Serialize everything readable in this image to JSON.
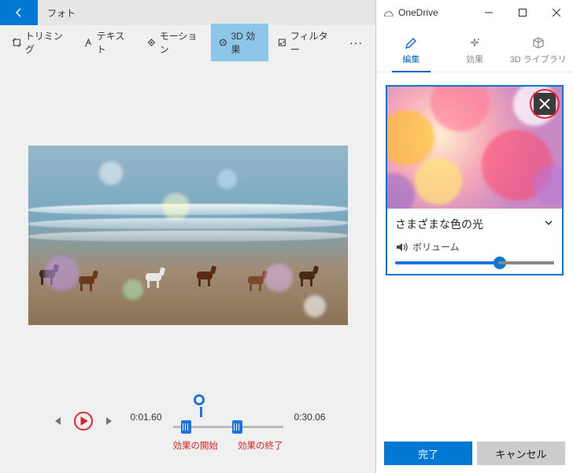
{
  "app_title": "フォト",
  "onedrive_title": "OneDrive",
  "toolbar": {
    "trim": "トリミング",
    "text": "テキスト",
    "motion": "モーション",
    "effects3d": "3D 効果",
    "filters": "フィルター"
  },
  "playback": {
    "current_time": "0:01.60",
    "total_time": "0:30.06",
    "start_label": "効果の開始",
    "end_label": "効果の終了"
  },
  "tabs": {
    "edit": "編集",
    "effects": "効果",
    "library3d": "3D ライブラリ"
  },
  "effect": {
    "name": "さまざまな色の光",
    "volume_label": "ボリューム",
    "volume_value": 65
  },
  "buttons": {
    "done": "完了",
    "cancel": "キャンセル"
  },
  "colors": {
    "accent": "#0078d4",
    "accent_light": "#8cc6e8",
    "danger": "#e23"
  }
}
